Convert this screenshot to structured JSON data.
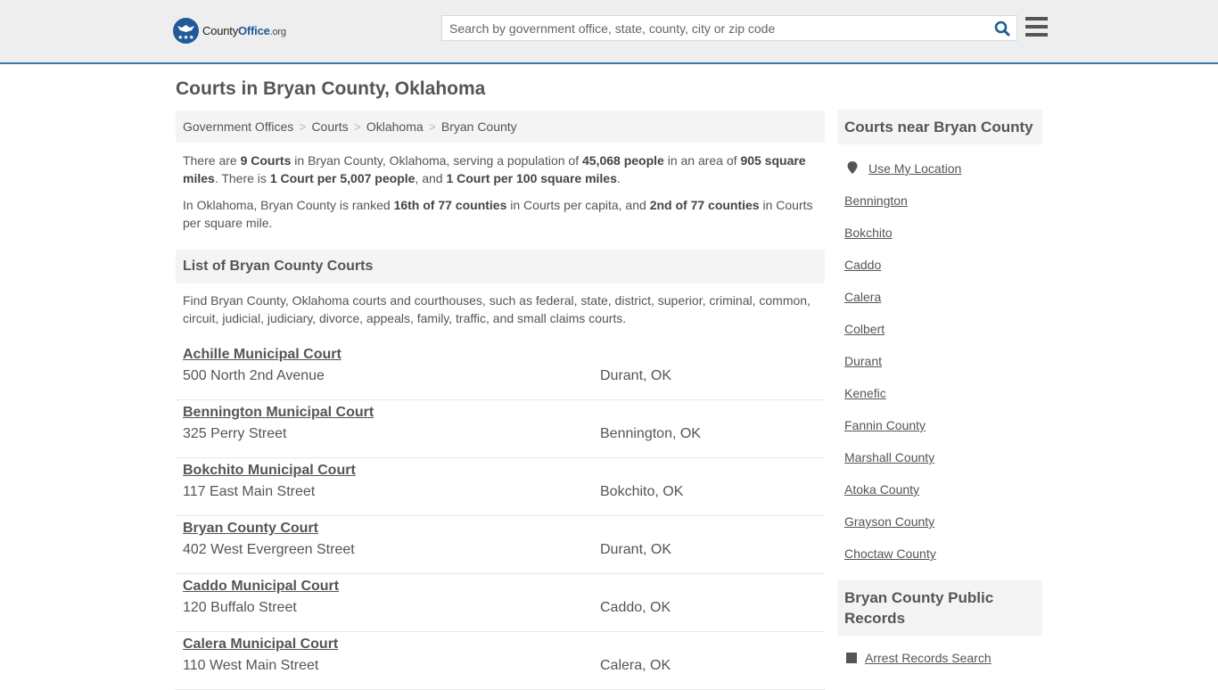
{
  "header": {
    "logo": {
      "county": "County",
      "office": "Office",
      "org": ".org"
    },
    "search": {
      "placeholder": "Search by government office, state, county, city or zip code",
      "value": ""
    },
    "colors": {
      "brand": "#1f5a9a",
      "header_border": "#3b77a8"
    }
  },
  "page_title": "Courts in Bryan County, Oklahoma",
  "breadcrumb": [
    {
      "label": "Government Offices"
    },
    {
      "label": "Courts"
    },
    {
      "label": "Oklahoma"
    },
    {
      "label": "Bryan County"
    }
  ],
  "summary": {
    "p1": {
      "t1": "There are ",
      "b1": "9 Courts",
      "t2": " in Bryan County, Oklahoma, serving a population of ",
      "b2": "45,068 people",
      "t3": " in an area of ",
      "b3": "905 square miles",
      "t4": ". There is ",
      "b4": "1 Court per 5,007 people",
      "t5": ", and ",
      "b5": "1 Court per 100 square miles",
      "t6": "."
    },
    "p2": {
      "t1": "In Oklahoma, Bryan County is ranked ",
      "b1": "16th of 77 counties",
      "t2": " in Courts per capita, and ",
      "b2": "2nd of 77 counties",
      "t3": " in Courts per square mile."
    }
  },
  "list": {
    "heading": "List of Bryan County Courts",
    "intro": "Find Bryan County, Oklahoma courts and courthouses, such as federal, state, district, superior, criminal, common, circuit, judicial, judiciary, divorce, appeals, family, traffic, and small claims courts.",
    "courts": [
      {
        "name": "Achille Municipal Court",
        "address": "500 North 2nd Avenue",
        "city": "Durant, OK"
      },
      {
        "name": "Bennington Municipal Court",
        "address": "325 Perry Street",
        "city": "Bennington, OK"
      },
      {
        "name": "Bokchito Municipal Court",
        "address": "117 East Main Street",
        "city": "Bokchito, OK"
      },
      {
        "name": "Bryan County Court",
        "address": "402 West Evergreen Street",
        "city": "Durant, OK"
      },
      {
        "name": "Caddo Municipal Court",
        "address": "120 Buffalo Street",
        "city": "Caddo, OK"
      },
      {
        "name": "Calera Municipal Court",
        "address": "110 West Main Street",
        "city": "Calera, OK"
      }
    ]
  },
  "sidebar": {
    "nearby_heading": "Courts near Bryan County",
    "use_location": "Use My Location",
    "nearby": [
      "Bennington",
      "Bokchito",
      "Caddo",
      "Calera",
      "Colbert",
      "Durant",
      "Kenefic",
      "Fannin County",
      "Marshall County",
      "Atoka County",
      "Grayson County",
      "Choctaw County"
    ],
    "records_heading": "Bryan County Public Records",
    "records": [
      "Arrest Records Search"
    ]
  }
}
